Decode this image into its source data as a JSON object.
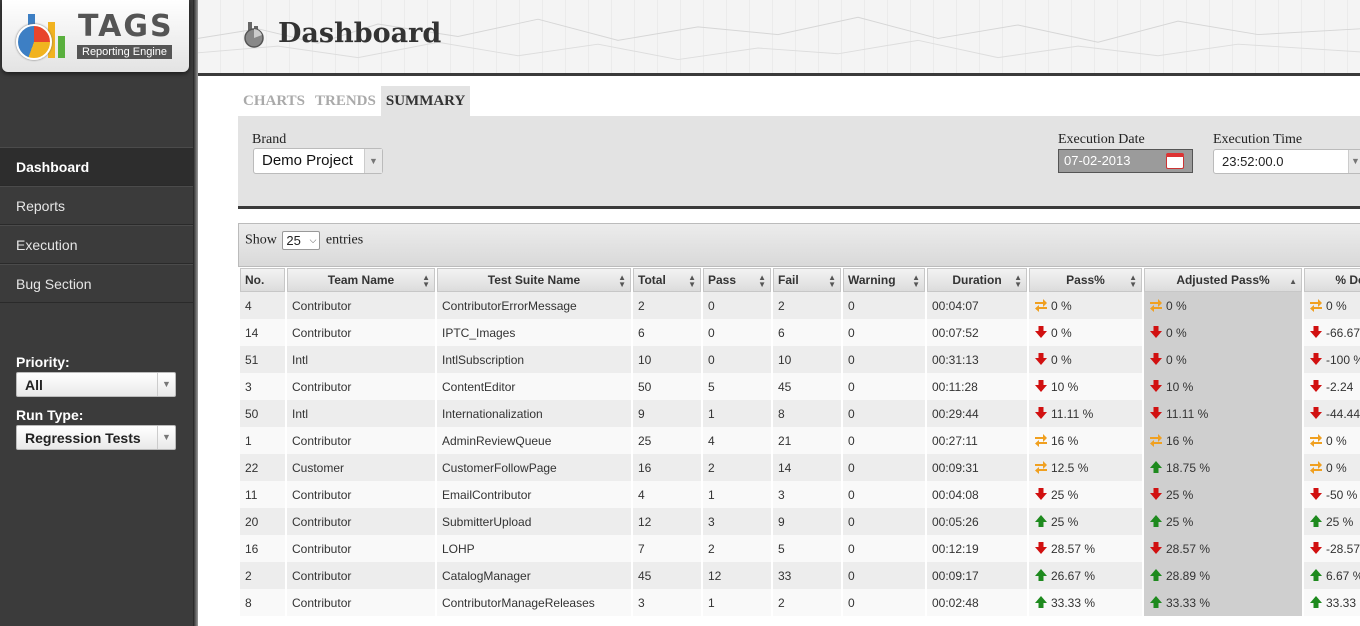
{
  "app": {
    "logo_title": "TAGS",
    "logo_subtitle": "Reporting Engine"
  },
  "sidebar": {
    "items": [
      {
        "label": "Dashboard",
        "active": true
      },
      {
        "label": "Reports",
        "active": false
      },
      {
        "label": "Execution",
        "active": false
      },
      {
        "label": "Bug Section",
        "active": false
      }
    ],
    "priority_label": "Priority:",
    "priority_value": "All",
    "run_type_label": "Run Type:",
    "run_type_value": "Regression Tests"
  },
  "header": {
    "title": "Dashboard"
  },
  "tabs": [
    {
      "label": "CHARTS",
      "active": false
    },
    {
      "label": "TRENDS",
      "active": false
    },
    {
      "label": "SUMMARY",
      "active": true
    }
  ],
  "filters": {
    "brand_label": "Brand",
    "brand_value": "Demo Project",
    "exec_date_label": "Execution Date",
    "exec_date_value": "07-02-2013",
    "exec_time_label": "Execution Time",
    "exec_time_value": "23:52:00.0"
  },
  "table": {
    "show_prefix": "Show",
    "page_length": "25",
    "show_suffix": "entries",
    "columns": [
      "No.",
      "Team Name",
      "Test Suite Name",
      "Total",
      "Pass",
      "Fail",
      "Warning",
      "Duration",
      "Pass%",
      "Adjusted Pass%",
      "% Delta"
    ],
    "rows": [
      {
        "no": "4",
        "team": "Contributor",
        "suite": "ContributorErrorMessage",
        "total": "2",
        "pass": "0",
        "fail": "2",
        "warning": "0",
        "duration": "00:04:07",
        "pass_pct": "0 %",
        "pass_ind": "neutral",
        "adj_pct": "0 %",
        "adj_ind": "neutral",
        "delta": "0 %",
        "delta_ind": "neutral"
      },
      {
        "no": "14",
        "team": "Contributor",
        "suite": "IPTC_Images",
        "total": "6",
        "pass": "0",
        "fail": "6",
        "warning": "0",
        "duration": "00:07:52",
        "pass_pct": "0 %",
        "pass_ind": "down",
        "adj_pct": "0 %",
        "adj_ind": "down",
        "delta": "-66.67",
        "delta_ind": "down"
      },
      {
        "no": "51",
        "team": "Intl",
        "suite": "IntlSubscription",
        "total": "10",
        "pass": "0",
        "fail": "10",
        "warning": "0",
        "duration": "00:31:13",
        "pass_pct": "0 %",
        "pass_ind": "down",
        "adj_pct": "0 %",
        "adj_ind": "down",
        "delta": "-100 %",
        "delta_ind": "down"
      },
      {
        "no": "3",
        "team": "Contributor",
        "suite": "ContentEditor",
        "total": "50",
        "pass": "5",
        "fail": "45",
        "warning": "0",
        "duration": "00:11:28",
        "pass_pct": "10 %",
        "pass_ind": "down",
        "adj_pct": "10 %",
        "adj_ind": "down",
        "delta": "-2.24",
        "delta_ind": "down"
      },
      {
        "no": "50",
        "team": "Intl",
        "suite": "Internationalization",
        "total": "9",
        "pass": "1",
        "fail": "8",
        "warning": "0",
        "duration": "00:29:44",
        "pass_pct": "11.11 %",
        "pass_ind": "down",
        "adj_pct": "11.11 %",
        "adj_ind": "down",
        "delta": "-44.44",
        "delta_ind": "down"
      },
      {
        "no": "1",
        "team": "Contributor",
        "suite": "AdminReviewQueue",
        "total": "25",
        "pass": "4",
        "fail": "21",
        "warning": "0",
        "duration": "00:27:11",
        "pass_pct": "16 %",
        "pass_ind": "neutral",
        "adj_pct": "16 %",
        "adj_ind": "neutral",
        "delta": "0 %",
        "delta_ind": "neutral"
      },
      {
        "no": "22",
        "team": "Customer",
        "suite": "CustomerFollowPage",
        "total": "16",
        "pass": "2",
        "fail": "14",
        "warning": "0",
        "duration": "00:09:31",
        "pass_pct": "12.5 %",
        "pass_ind": "neutral",
        "adj_pct": "18.75 %",
        "adj_ind": "up",
        "delta": "0 %",
        "delta_ind": "neutral"
      },
      {
        "no": "11",
        "team": "Contributor",
        "suite": "EmailContributor",
        "total": "4",
        "pass": "1",
        "fail": "3",
        "warning": "0",
        "duration": "00:04:08",
        "pass_pct": "25 %",
        "pass_ind": "down",
        "adj_pct": "25 %",
        "adj_ind": "down",
        "delta": "-50 %",
        "delta_ind": "down"
      },
      {
        "no": "20",
        "team": "Contributor",
        "suite": "SubmitterUpload",
        "total": "12",
        "pass": "3",
        "fail": "9",
        "warning": "0",
        "duration": "00:05:26",
        "pass_pct": "25 %",
        "pass_ind": "up",
        "adj_pct": "25 %",
        "adj_ind": "up",
        "delta": "25 %",
        "delta_ind": "up"
      },
      {
        "no": "16",
        "team": "Contributor",
        "suite": "LOHP",
        "total": "7",
        "pass": "2",
        "fail": "5",
        "warning": "0",
        "duration": "00:12:19",
        "pass_pct": "28.57 %",
        "pass_ind": "down",
        "adj_pct": "28.57 %",
        "adj_ind": "down",
        "delta": "-28.57",
        "delta_ind": "down"
      },
      {
        "no": "2",
        "team": "Contributor",
        "suite": "CatalogManager",
        "total": "45",
        "pass": "12",
        "fail": "33",
        "warning": "0",
        "duration": "00:09:17",
        "pass_pct": "26.67 %",
        "pass_ind": "up",
        "adj_pct": "28.89 %",
        "adj_ind": "up",
        "delta": "6.67 %",
        "delta_ind": "up"
      },
      {
        "no": "8",
        "team": "Contributor",
        "suite": "ContributorManageReleases",
        "total": "3",
        "pass": "1",
        "fail": "2",
        "warning": "0",
        "duration": "00:02:48",
        "pass_pct": "33.33 %",
        "pass_ind": "up",
        "adj_pct": "33.33 %",
        "adj_ind": "up",
        "delta": "33.33",
        "delta_ind": "up"
      }
    ]
  },
  "colors": {
    "up": "#1e8a1e",
    "down": "#d11010",
    "neutral": "#f0a020"
  }
}
